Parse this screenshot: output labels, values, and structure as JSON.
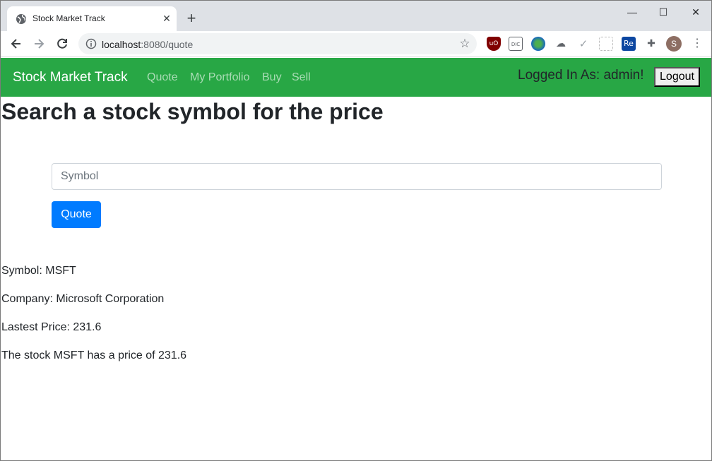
{
  "browser": {
    "tab_title": "Stock Market Track",
    "tab_close_glyph": "✕",
    "new_tab_glyph": "+",
    "url_host": "localhost",
    "url_path": ":8080/quote",
    "window_controls": {
      "minimize": "—",
      "maximize": "☐",
      "close": "✕"
    },
    "extensions": [
      "ublock-icon",
      "dictionary-icon",
      "globe-ext-icon",
      "cloud-ext-icon",
      "check-ext-icon",
      "grid-ext-icon",
      "re-ext-icon",
      "puzzle-icon"
    ],
    "profile_initial": "S",
    "menu_glyph": "⋮",
    "star_glyph": "☆"
  },
  "navbar": {
    "brand": "Stock Market Track",
    "links": [
      "Quote",
      "My Portfolio",
      "Buy",
      "Sell"
    ],
    "logged_in": "Logged In As: admin!",
    "logout_label": "Logout",
    "color": "#28a745"
  },
  "main": {
    "heading": "Search a stock symbol for the price",
    "symbol_placeholder": "Symbol",
    "symbol_value": "",
    "quote_button": "Quote",
    "quote_button_color": "#007bff"
  },
  "result": {
    "symbol_line": "Symbol: MSFT",
    "company_line": "Company: Microsoft Corporation",
    "price_line": "Lastest Price: 231.6",
    "summary_line": "The stock MSFT has a price of 231.6"
  }
}
